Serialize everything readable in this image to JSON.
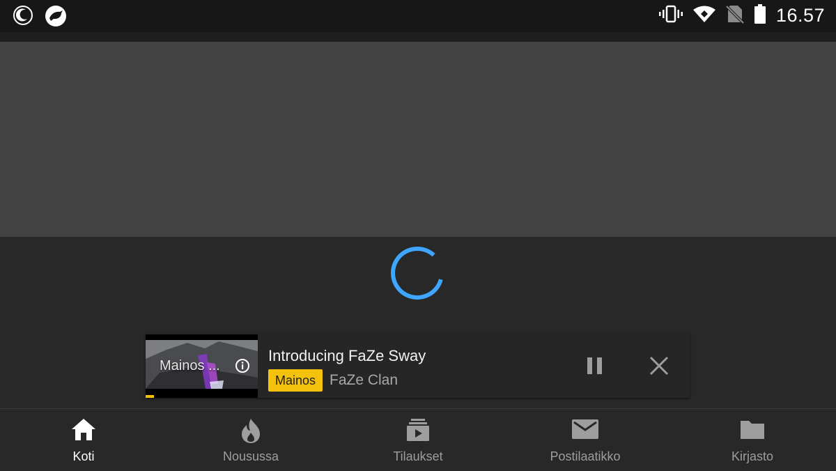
{
  "status_bar": {
    "time": "16.57",
    "left_icons": [
      "moon-notification-icon",
      "bird-notification-icon"
    ],
    "right_icons": [
      "vibrate-icon",
      "wifi-icon",
      "no-sim-icon",
      "battery-icon"
    ]
  },
  "player": {
    "loading": true,
    "spinner_color": "#3ea6ff"
  },
  "mini_player": {
    "thumbnail_label": "Mainos ...",
    "title": "Introducing FaZe Sway",
    "ad_badge": "Mainos",
    "channel": "FaZe Clan",
    "ad_badge_color": "#f4c20d"
  },
  "bottom_nav": {
    "items": [
      {
        "label": "Koti",
        "icon": "home-icon",
        "active": true
      },
      {
        "label": "Nousussa",
        "icon": "flame-icon",
        "active": false
      },
      {
        "label": "Tilaukset",
        "icon": "subscriptions-icon",
        "active": false
      },
      {
        "label": "Postilaatikko",
        "icon": "mail-icon",
        "active": false
      },
      {
        "label": "Kirjasto",
        "icon": "folder-icon",
        "active": false
      }
    ]
  }
}
